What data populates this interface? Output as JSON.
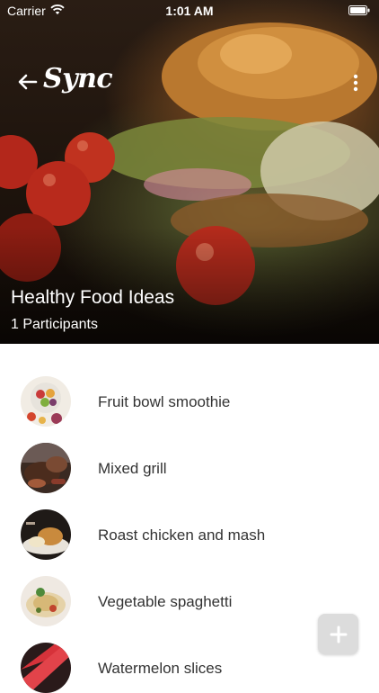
{
  "status_bar": {
    "carrier": "Carrier",
    "time": "1:01 AM"
  },
  "header": {
    "app_name": "Sync",
    "group_title": "Healthy Food Ideas",
    "participants": "1 Participants"
  },
  "ideas": [
    {
      "label": "Fruit bowl smoothie"
    },
    {
      "label": "Mixed grill"
    },
    {
      "label": "Roast chicken and mash"
    },
    {
      "label": "Vegetable spaghetti"
    },
    {
      "label": "Watermelon slices"
    }
  ],
  "colors": {
    "fab_background": "#dcdcdc",
    "list_text": "#333333"
  },
  "icons": [
    "wifi-icon",
    "battery-icon",
    "back-arrow-icon",
    "more-vertical-icon",
    "plus-icon"
  ]
}
